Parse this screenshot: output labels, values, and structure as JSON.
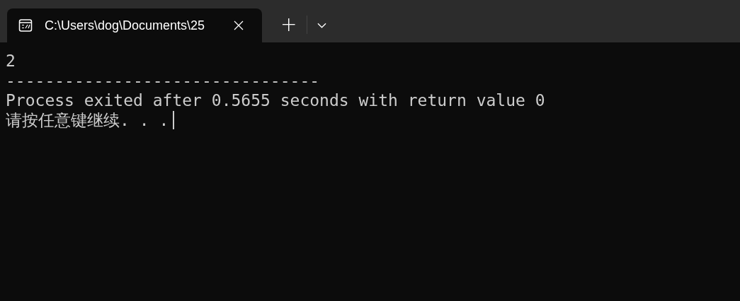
{
  "tabs": [
    {
      "title": "C:\\Users\\dog\\Documents\\25",
      "selected": true
    }
  ],
  "new_tab_button": "+",
  "terminal": {
    "lines": [
      "2",
      "--------------------------------",
      "Process exited after 0.5655 seconds with return value 0",
      "请按任意键继续. . ."
    ]
  }
}
